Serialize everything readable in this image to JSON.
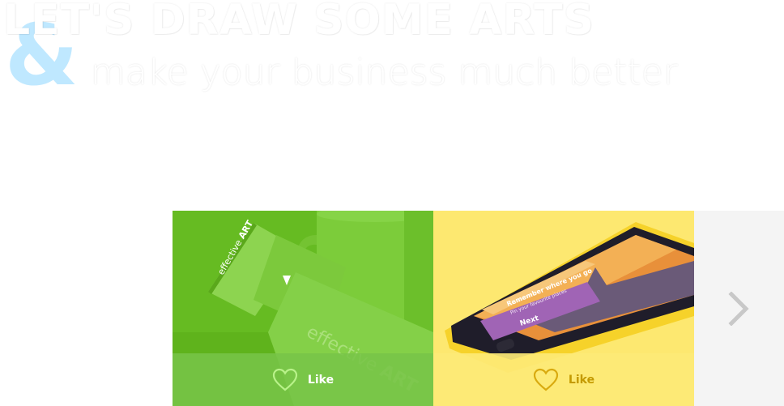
{
  "hero": {
    "title": "LET'S DRAW SOME ARTS",
    "ampersand": "&",
    "subtitle": "make your business much better"
  },
  "gallery": {
    "tiles": [
      {
        "image_text_1": "effective",
        "image_text_2": "ART",
        "like_label": "Like",
        "like_icon": "heart-outline-icon",
        "heart_color": "#b9f28a"
      },
      {
        "phone_heading": "Remember where you go",
        "phone_body": "Pin your favourite places",
        "phone_button": "Next",
        "like_label": "Like",
        "like_icon": "heart-outline-icon",
        "heart_color": "#d9aa0f"
      }
    ],
    "next_icon": "chevron-right-icon"
  },
  "colors": {
    "green_tile": "#6cc127",
    "yellow_tile": "#fde870",
    "accent_blue": "#bfe8ff",
    "next_panel": "#f4f4f4"
  }
}
